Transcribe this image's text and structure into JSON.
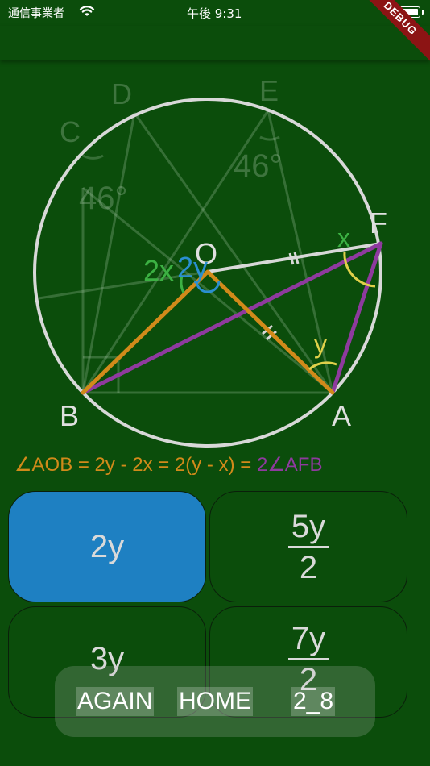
{
  "status_bar": {
    "carrier": "通信事業者",
    "time": "午後 9:31"
  },
  "debug_banner": "DEBUG",
  "diagram": {
    "points": {
      "A": "A",
      "B": "B",
      "C": "C",
      "D": "D",
      "E": "E",
      "F": "F",
      "O": "O"
    },
    "angle_labels": {
      "angle_c": "46°",
      "angle_e": "46°",
      "angle_x": "x",
      "angle_y": "y",
      "angle_2x": "2x",
      "angle_2y": "2y"
    }
  },
  "equation": {
    "part1": "∠AOB = 2y - 2x = 2(y - x) = ",
    "part2": "2∠AFB"
  },
  "choices": [
    {
      "label": "2y",
      "type": "plain",
      "selected": true
    },
    {
      "numerator": "5y",
      "denominator": "2",
      "type": "fraction",
      "selected": false
    },
    {
      "label": "3y",
      "type": "plain",
      "selected": false
    },
    {
      "numerator": "7y",
      "denominator": "2",
      "type": "fraction",
      "selected": false
    }
  ],
  "bottom_nav": {
    "again": "AGAIN",
    "home": "HOME",
    "level": "2_8"
  },
  "colors": {
    "background": "#0b4d0b",
    "selected": "#1e80c2",
    "orange": "#d18a1a",
    "purple": "#8e3a9e",
    "yellow": "#e0d04a",
    "green_label": "#3cb043",
    "blue_label": "#2a8fd0"
  }
}
